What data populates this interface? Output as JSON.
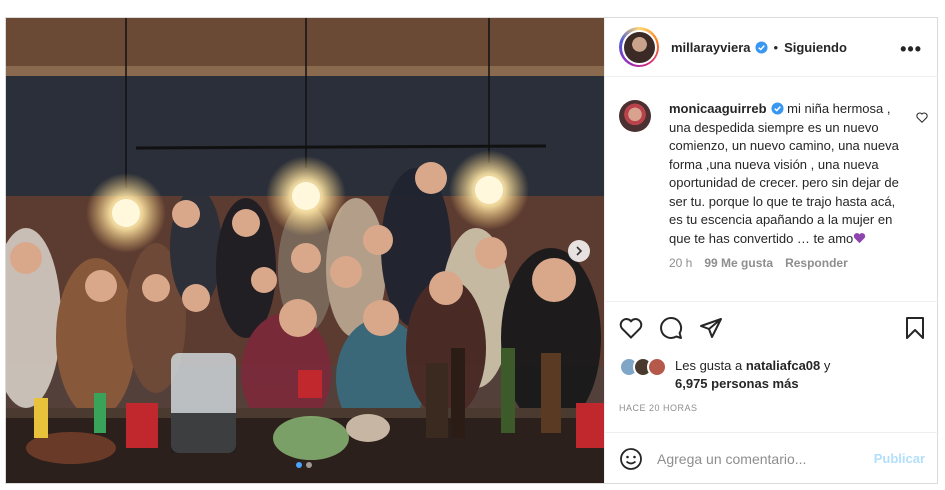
{
  "post": {
    "username": "millarayviera",
    "separator": "•",
    "follow_status": "Siguiendo",
    "more_label": "•••"
  },
  "comment": {
    "username": "monicaaguirreb",
    "text": " mi niña hermosa , una despedida siempre es un nuevo comienzo, un nuevo camino, una nueva forma ,una nueva visión , una nueva oportunidad de crecer. pero sin dejar de ser tu. porque lo que te trajo hasta acá, es tu escencia apañando a la mujer en que te has convertido … te amo",
    "emoji": "purple-heart",
    "time": "20 h",
    "likes": "99 Me gusta",
    "reply": "Responder"
  },
  "likes": {
    "prefix": "Les gusta a ",
    "user": "nataliafca08",
    "suffix": " y",
    "others": "6,975 personas más"
  },
  "timestamp": "HACE 20 HORAS",
  "add_comment": {
    "placeholder": "Agrega un comentario...",
    "publish": "Publicar"
  },
  "icons": [
    "verified-icon",
    "more-icon",
    "heart-icon",
    "comment-icon",
    "share-icon",
    "save-icon",
    "emoji-icon",
    "chevron-right-icon"
  ],
  "colors": {
    "verified": "#3897f0",
    "publish": "#b2dffc",
    "meta": "#8e8e8e",
    "purple_heart": "#8e44ad"
  }
}
